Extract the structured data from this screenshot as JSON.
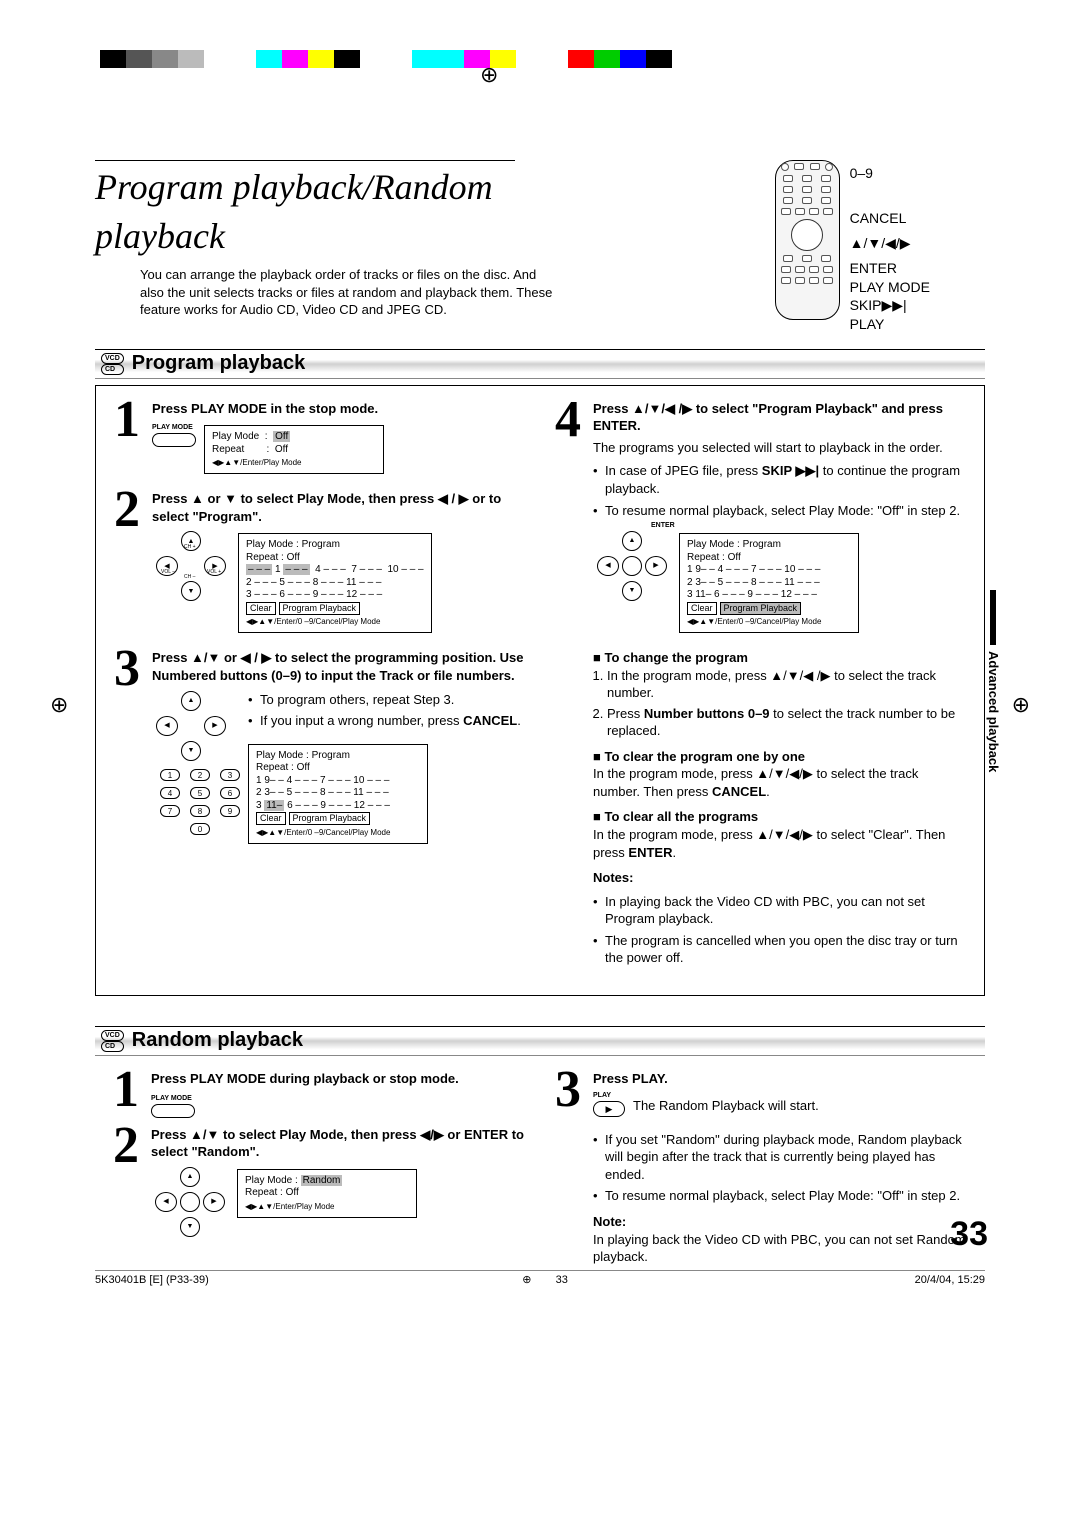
{
  "header": {
    "title": "Program playback/Random playback",
    "intro": "You can arrange the playback order of tracks or files on the disc. And also the unit selects tracks or files at random and playback them. These feature works for Audio CD, Video CD and JPEG CD."
  },
  "remote_labels": {
    "a": "0–9",
    "b": "CANCEL",
    "c": "▲/▼/◀/▶",
    "d": "ENTER",
    "e": "PLAY MODE",
    "f": "SKIP▶▶|",
    "g": "PLAY"
  },
  "section1": {
    "badge1": "VCD",
    "badge2": "CD",
    "title": "Program playback",
    "step1_title": "Press PLAY MODE in the stop mode.",
    "playmode_label": "PLAY MODE",
    "osd1_l1a": "Play Mode",
    "osd1_l1b": "Off",
    "osd1_l2a": "Repeat",
    "osd1_l2b": "Off",
    "osd1_hint": "◀▶▲▼/Enter/Play Mode",
    "step2_title": "Press ▲ or ▼ to select Play Mode, then press ◀ / ▶ or to select \"Program\".",
    "osd2_l1": "Play Mode        :   Program",
    "osd2_l2": "Repeat           :   Off",
    "osd2_r1": "1 – – –   4 – – –   7 – – –   10 – – –",
    "osd2_r2": "2 – – –   5 – – –   8 – – –   11 – – –",
    "osd2_r3": "3 – – –   6 – – –   9 – – –   12 – – –",
    "osd2_clear": "Clear",
    "osd2_pp": "Program Playback",
    "osd2_hint": "◀▶▲▼/Enter/0 –9/Cancel/Play Mode",
    "step3_title": "Press ▲/▼ or ◀ / ▶ to select the programming position. Use Numbered buttons (0–9) to input the Track or file numbers.",
    "step3_b1": "To program others, repeat Step 3.",
    "step3_b2": "If you input a wrong number, press CANCEL.",
    "step3_cancel": "CANCEL",
    "osd3_l1": "Play Mode        :   Program",
    "osd3_l2": "Repeat           :   Off",
    "osd3_r1": "1 9– –   4 – – –   7 – – –   10 – – –",
    "osd3_r2": "2 3– –   5 – – –   8 – – –   11 – – –",
    "osd3_r3a": "3 ",
    "osd3_r3b": "11–",
    "osd3_r3c": "   6 – – –   9 – – –   12 – – –",
    "osd3_hint": "◀▶▲▼/Enter/0 –9/Cancel/Play Mode",
    "step4_title": "Press ▲/▼/◀ /▶ to select \"Program Playback\" and press ENTER.",
    "step4_desc": "The programs you selected will start to playback in the order.",
    "step4_b1a": "In case of JPEG file, press ",
    "step4_b1b": "SKIP ▶▶|",
    "step4_b1c": " to continue the program playback.",
    "step4_b2": "To resume normal playback, select Play Mode: \"Off\" in step 2.",
    "enter_label": "ENTER",
    "osd4_l1": "Play Mode        :   Program",
    "osd4_l2": "Repeat           :   Off",
    "osd4_r1": "1 9– –   4 – – –   7 – – –   10 – – –",
    "osd4_r2": "2 3– –   5 – – –   8 – – –   11 – – –",
    "osd4_r3": "3 11–   6 – – –   9 – – –   12 – – –",
    "osd4_hint": "◀▶▲▼/Enter/0 –9/Cancel/Play Mode",
    "sub1": "To change the program",
    "sub1_l1": "In the program mode, press ▲/▼/◀ /▶ to select the track number.",
    "sub1_l2a": "Press ",
    "sub1_l2b": "Number buttons 0–9",
    "sub1_l2c": " to select the track number to be replaced.",
    "sub2": "To clear the program one by one",
    "sub2_l1a": "In the program mode, press ▲/▼/◀/▶ to select the track number. Then press ",
    "sub2_l1b": "CANCEL",
    "sub2_l1c": ".",
    "sub3": "To clear all the programs",
    "sub3_l1a": "In the program mode, press ▲/▼/◀/▶ to select \"Clear\". Then press ",
    "sub3_l1b": "ENTER",
    "sub3_l1c": ".",
    "notes_label": "Notes:",
    "note1": "In playing back the Video CD with PBC, you can not set Program playback.",
    "note2": "The program is cancelled when you open the disc tray or turn the power off."
  },
  "section2": {
    "badge1": "VCD",
    "badge2": "CD",
    "title": "Random playback",
    "step1_title": "Press PLAY MODE during playback or stop mode.",
    "step2_title": "Press ▲/▼ to select Play Mode, then press ◀/▶ or ENTER to select \"Random\".",
    "osd_l1a": "Play Mode        :   ",
    "osd_l1b": "Random",
    "osd_l2": "Repeat           :   Off",
    "osd_hint": "◀▶▲▼/Enter/Play Mode",
    "step3_title": "Press PLAY.",
    "step3_desc": "The Random Playback will start.",
    "step3_b1": "If you set \"Random\" during playback mode, Random playback will begin after the track that is currently being played has ended.",
    "step3_b2": "To resume normal playback, select Play Mode: \"Off\" in step 2.",
    "play_label": "PLAY",
    "note_label": "Note:",
    "note": "In playing back the Video CD with PBC, you can not set Random playback."
  },
  "sidetab": "Advanced playback",
  "page_number": "33",
  "footer": {
    "left": "5K30401B [E] (P33-39)",
    "mid": "33",
    "right": "20/4/04, 15:29"
  },
  "dpad": {
    "ch_up": "CH +",
    "ch_dn": "CH –",
    "vol_dn": "VOL –",
    "vol_up": "VOL +"
  }
}
